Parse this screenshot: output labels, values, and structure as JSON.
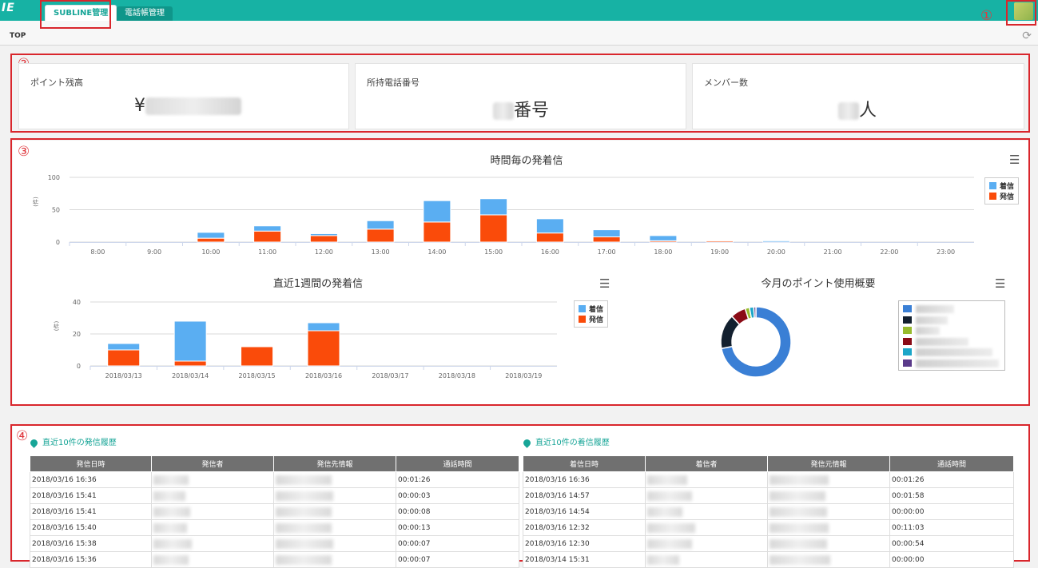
{
  "header": {
    "logo_text": "IE",
    "tabs": [
      {
        "label": "SUBLINE管理"
      },
      {
        "label": "電話帳管理"
      }
    ],
    "avatar_icon": "user-avatar"
  },
  "breadcrumb": {
    "label": "TOP",
    "refresh_icon": "refresh-icon"
  },
  "annotations": [
    "①",
    "②",
    "③",
    "④"
  ],
  "summary_cards": [
    {
      "label": "ポイント残高",
      "prefix": "¥",
      "suffix": ""
    },
    {
      "label": "所持電話番号",
      "prefix": "",
      "suffix": "番号"
    },
    {
      "label": "メンバー数",
      "prefix": "",
      "suffix": "人"
    }
  ],
  "colors": {
    "incoming": "#5aaef2",
    "outgoing": "#fa4b0a",
    "teal": "#17b2a4",
    "annotation_red": "#d9262c"
  },
  "chart_data": [
    {
      "type": "bar",
      "stacked": true,
      "title": "時間毎の発着信",
      "ylabel": "(件)",
      "ylim": [
        0,
        100
      ],
      "yticks": [
        0,
        50,
        100
      ],
      "categories": [
        "8:00",
        "9:00",
        "10:00",
        "11:00",
        "12:00",
        "13:00",
        "14:00",
        "15:00",
        "16:00",
        "17:00",
        "18:00",
        "19:00",
        "20:00",
        "21:00",
        "22:00",
        "23:00"
      ],
      "series": [
        {
          "name": "発信",
          "color": "#fa4b0a",
          "values": [
            0,
            0,
            6,
            17,
            10,
            20,
            31,
            42,
            14,
            8,
            2,
            2,
            0,
            0,
            0,
            0
          ]
        },
        {
          "name": "着信",
          "color": "#5aaef2",
          "values": [
            0,
            0,
            9,
            8,
            3,
            13,
            33,
            25,
            22,
            11,
            8,
            1,
            2,
            0,
            0,
            0
          ]
        }
      ],
      "legend": "top-right",
      "grid": true
    },
    {
      "type": "bar",
      "stacked": true,
      "title": "直近1週間の発着信",
      "ylabel": "(件)",
      "ylim": [
        0,
        40
      ],
      "yticks": [
        0,
        20,
        40
      ],
      "categories": [
        "2018/03/13",
        "2018/03/14",
        "2018/03/15",
        "2018/03/16",
        "2018/03/17",
        "2018/03/18",
        "2018/03/19"
      ],
      "series": [
        {
          "name": "発信",
          "color": "#fa4b0a",
          "values": [
            10,
            3,
            12,
            22,
            0,
            0,
            0
          ]
        },
        {
          "name": "着信",
          "color": "#5aaef2",
          "values": [
            4,
            25,
            0,
            5,
            0,
            0,
            0
          ]
        }
      ],
      "legend": "right",
      "grid": true
    },
    {
      "type": "pie",
      "donut": true,
      "title": "今月のポイント使用概要",
      "slices": [
        {
          "value": 72,
          "color": "#3a7fd5"
        },
        {
          "value": 16,
          "color": "#13202f"
        },
        {
          "value": 7,
          "color": "#8a0b16"
        },
        {
          "value": 2,
          "color": "#97bb2d"
        },
        {
          "value": 2,
          "color": "#1ba6c8"
        },
        {
          "value": 1,
          "color": "#5a3a8a"
        }
      ],
      "legend_colors": [
        "#3a7fd5",
        "#13202f",
        "#97bb2d",
        "#8a0b16",
        "#1ba6c8",
        "#5a3a8a"
      ],
      "legend": "right"
    }
  ],
  "outgoing_history": {
    "title": "直近10件の発信履歴",
    "columns": [
      "発信日時",
      "発信者",
      "発信先情報",
      "通話時間"
    ],
    "rows": [
      {
        "datetime": "2018/03/16 16:36",
        "duration": "00:01:26"
      },
      {
        "datetime": "2018/03/16 15:41",
        "duration": "00:00:03"
      },
      {
        "datetime": "2018/03/16 15:41",
        "duration": "00:00:08"
      },
      {
        "datetime": "2018/03/16 15:40",
        "duration": "00:00:13"
      },
      {
        "datetime": "2018/03/16 15:38",
        "duration": "00:00:07"
      },
      {
        "datetime": "2018/03/16 15:36",
        "duration": "00:00:07"
      }
    ]
  },
  "incoming_history": {
    "title": "直近10件の着信履歴",
    "columns": [
      "着信日時",
      "着信者",
      "発信元情報",
      "通話時間"
    ],
    "rows": [
      {
        "datetime": "2018/03/16 16:36",
        "duration": "00:01:26"
      },
      {
        "datetime": "2018/03/16 14:57",
        "duration": "00:01:58"
      },
      {
        "datetime": "2018/03/16 14:54",
        "duration": "00:00:00"
      },
      {
        "datetime": "2018/03/16 12:32",
        "duration": "00:11:03"
      },
      {
        "datetime": "2018/03/16 12:30",
        "duration": "00:00:54"
      },
      {
        "datetime": "2018/03/14 15:31",
        "duration": "00:00:00"
      }
    ]
  }
}
